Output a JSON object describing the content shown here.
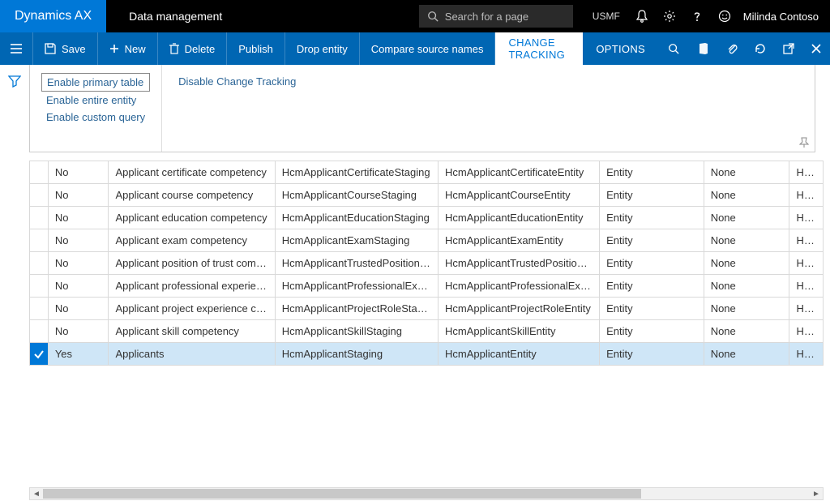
{
  "navbar": {
    "brand": "Dynamics AX",
    "title": "Data management",
    "search_placeholder": "Search for a page",
    "company": "USMF",
    "username": "Milinda Contoso"
  },
  "actionbar": {
    "save": "Save",
    "new": "New",
    "delete": "Delete",
    "publish": "Publish",
    "drop_entity": "Drop entity",
    "compare": "Compare source names",
    "tab_change_tracking": "CHANGE TRACKING",
    "tab_options": "OPTIONS"
  },
  "dropdown": {
    "col1": {
      "enable_primary": "Enable primary table",
      "enable_entity": "Enable entire entity",
      "enable_custom": "Enable custom query"
    },
    "col2": {
      "disable": "Disable Change Tracking"
    }
  },
  "grid": {
    "rows": [
      {
        "sel": "No",
        "c3": "Applicant certificate competency",
        "c4": "HcmApplicantCertificateStaging",
        "c5": "HcmApplicantCertificateEntity",
        "c6": "Entity",
        "c7": "None",
        "c8": "Hcm"
      },
      {
        "sel": "No",
        "c3": "Applicant course competency",
        "c4": "HcmApplicantCourseStaging",
        "c5": "HcmApplicantCourseEntity",
        "c6": "Entity",
        "c7": "None",
        "c8": "Hcm"
      },
      {
        "sel": "No",
        "c3": "Applicant education competency",
        "c4": "HcmApplicantEducationStaging",
        "c5": "HcmApplicantEducationEntity",
        "c6": "Entity",
        "c7": "None",
        "c8": "Hcm"
      },
      {
        "sel": "No",
        "c3": "Applicant exam competency",
        "c4": "HcmApplicantExamStaging",
        "c5": "HcmApplicantExamEntity",
        "c6": "Entity",
        "c7": "None",
        "c8": "Hcm"
      },
      {
        "sel": "No",
        "c3": "Applicant position of trust comp...",
        "c4": "HcmApplicantTrustedPositionSt...",
        "c5": "HcmApplicantTrustedPositionEn...",
        "c6": "Entity",
        "c7": "None",
        "c8": "Hcm"
      },
      {
        "sel": "No",
        "c3": "Applicant professional experien...",
        "c4": "HcmApplicantProfessionalExperi...",
        "c5": "HcmApplicantProfessionalExperi...",
        "c6": "Entity",
        "c7": "None",
        "c8": "Hcm"
      },
      {
        "sel": "No",
        "c3": "Applicant project experience co...",
        "c4": "HcmApplicantProjectRoleStaging",
        "c5": "HcmApplicantProjectRoleEntity",
        "c6": "Entity",
        "c7": "None",
        "c8": "Hcm"
      },
      {
        "sel": "No",
        "c3": "Applicant skill competency",
        "c4": "HcmApplicantSkillStaging",
        "c5": "HcmApplicantSkillEntity",
        "c6": "Entity",
        "c7": "None",
        "c8": "Hcm"
      },
      {
        "sel": "Yes",
        "c3": "Applicants",
        "c4": "HcmApplicantStaging",
        "c5": "HcmApplicantEntity",
        "c6": "Entity",
        "c7": "None",
        "c8": "Hcm",
        "selected": true
      }
    ]
  }
}
